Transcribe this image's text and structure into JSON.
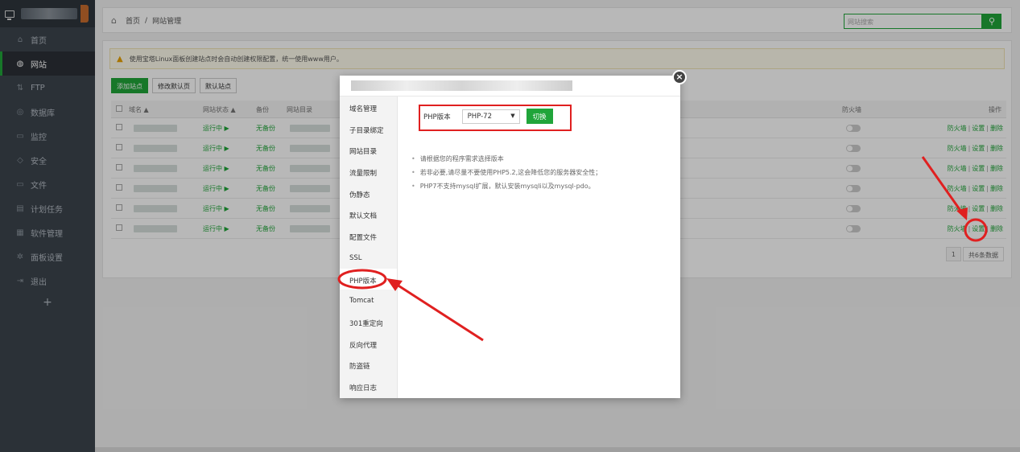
{
  "sidebar": {
    "items": [
      {
        "label": "首页",
        "icon": "home-icon"
      },
      {
        "label": "网站",
        "icon": "globe-icon"
      },
      {
        "label": "FTP",
        "icon": "ftp-icon"
      },
      {
        "label": "数据库",
        "icon": "database-icon"
      },
      {
        "label": "监控",
        "icon": "monitor-icon"
      },
      {
        "label": "安全",
        "icon": "shield-icon"
      },
      {
        "label": "文件",
        "icon": "folder-icon"
      },
      {
        "label": "计划任务",
        "icon": "calendar-icon"
      },
      {
        "label": "软件管理",
        "icon": "apps-icon"
      },
      {
        "label": "面板设置",
        "icon": "gear-icon"
      },
      {
        "label": "退出",
        "icon": "logout-icon"
      }
    ],
    "add": "+"
  },
  "header": {
    "home": "首页",
    "sep": "/",
    "current": "网站管理",
    "search_placeholder": "网站搜索"
  },
  "notice": "使用宝塔Linux面板创建站点时会自动创建权限配置，统一使用www用户。",
  "buttons": {
    "add_site": "添加站点",
    "edit_default_page": "修改默认页",
    "default_site": "默认站点"
  },
  "table": {
    "headers": {
      "domain": "域名 ▲",
      "status": "网站状态 ▲",
      "backup": "备份",
      "root": "网站目录",
      "firewall": "防火墙",
      "ops": "操作"
    },
    "rows": [
      {
        "status": "运行中 ▶",
        "backup": "无备份"
      },
      {
        "status": "运行中 ▶",
        "backup": "无备份"
      },
      {
        "status": "运行中 ▶",
        "backup": "无备份"
      },
      {
        "status": "运行中 ▶",
        "backup": "无备份"
      },
      {
        "status": "运行中 ▶",
        "backup": "无备份"
      },
      {
        "status": "运行中 ▶",
        "backup": "无备份"
      }
    ],
    "ops": {
      "firewall": "防火墙",
      "settings": "设置",
      "delete": "删除",
      "sep": "|"
    }
  },
  "pager": {
    "page": "1",
    "total": "共6条数据"
  },
  "modal": {
    "menu": [
      "域名管理",
      "子目录绑定",
      "网站目录",
      "流量限制",
      "伪静态",
      "默认文档",
      "配置文件",
      "SSL",
      "PHP版本",
      "Tomcat",
      "301重定向",
      "反向代理",
      "防盗链",
      "响应日志"
    ],
    "active_index": 8,
    "php_label": "PHP版本",
    "php_value": "PHP-72",
    "switch_label": "切换",
    "notes": [
      "请根据您的程序需求选择版本",
      "若非必要,请尽量不要使用PHP5.2,这会降低您的服务器安全性；",
      "PHP7不支持mysql扩展，默认安装mysqli以及mysql-pdo。"
    ]
  },
  "colors": {
    "accent": "#20a53a",
    "annotation": "#e02020"
  }
}
